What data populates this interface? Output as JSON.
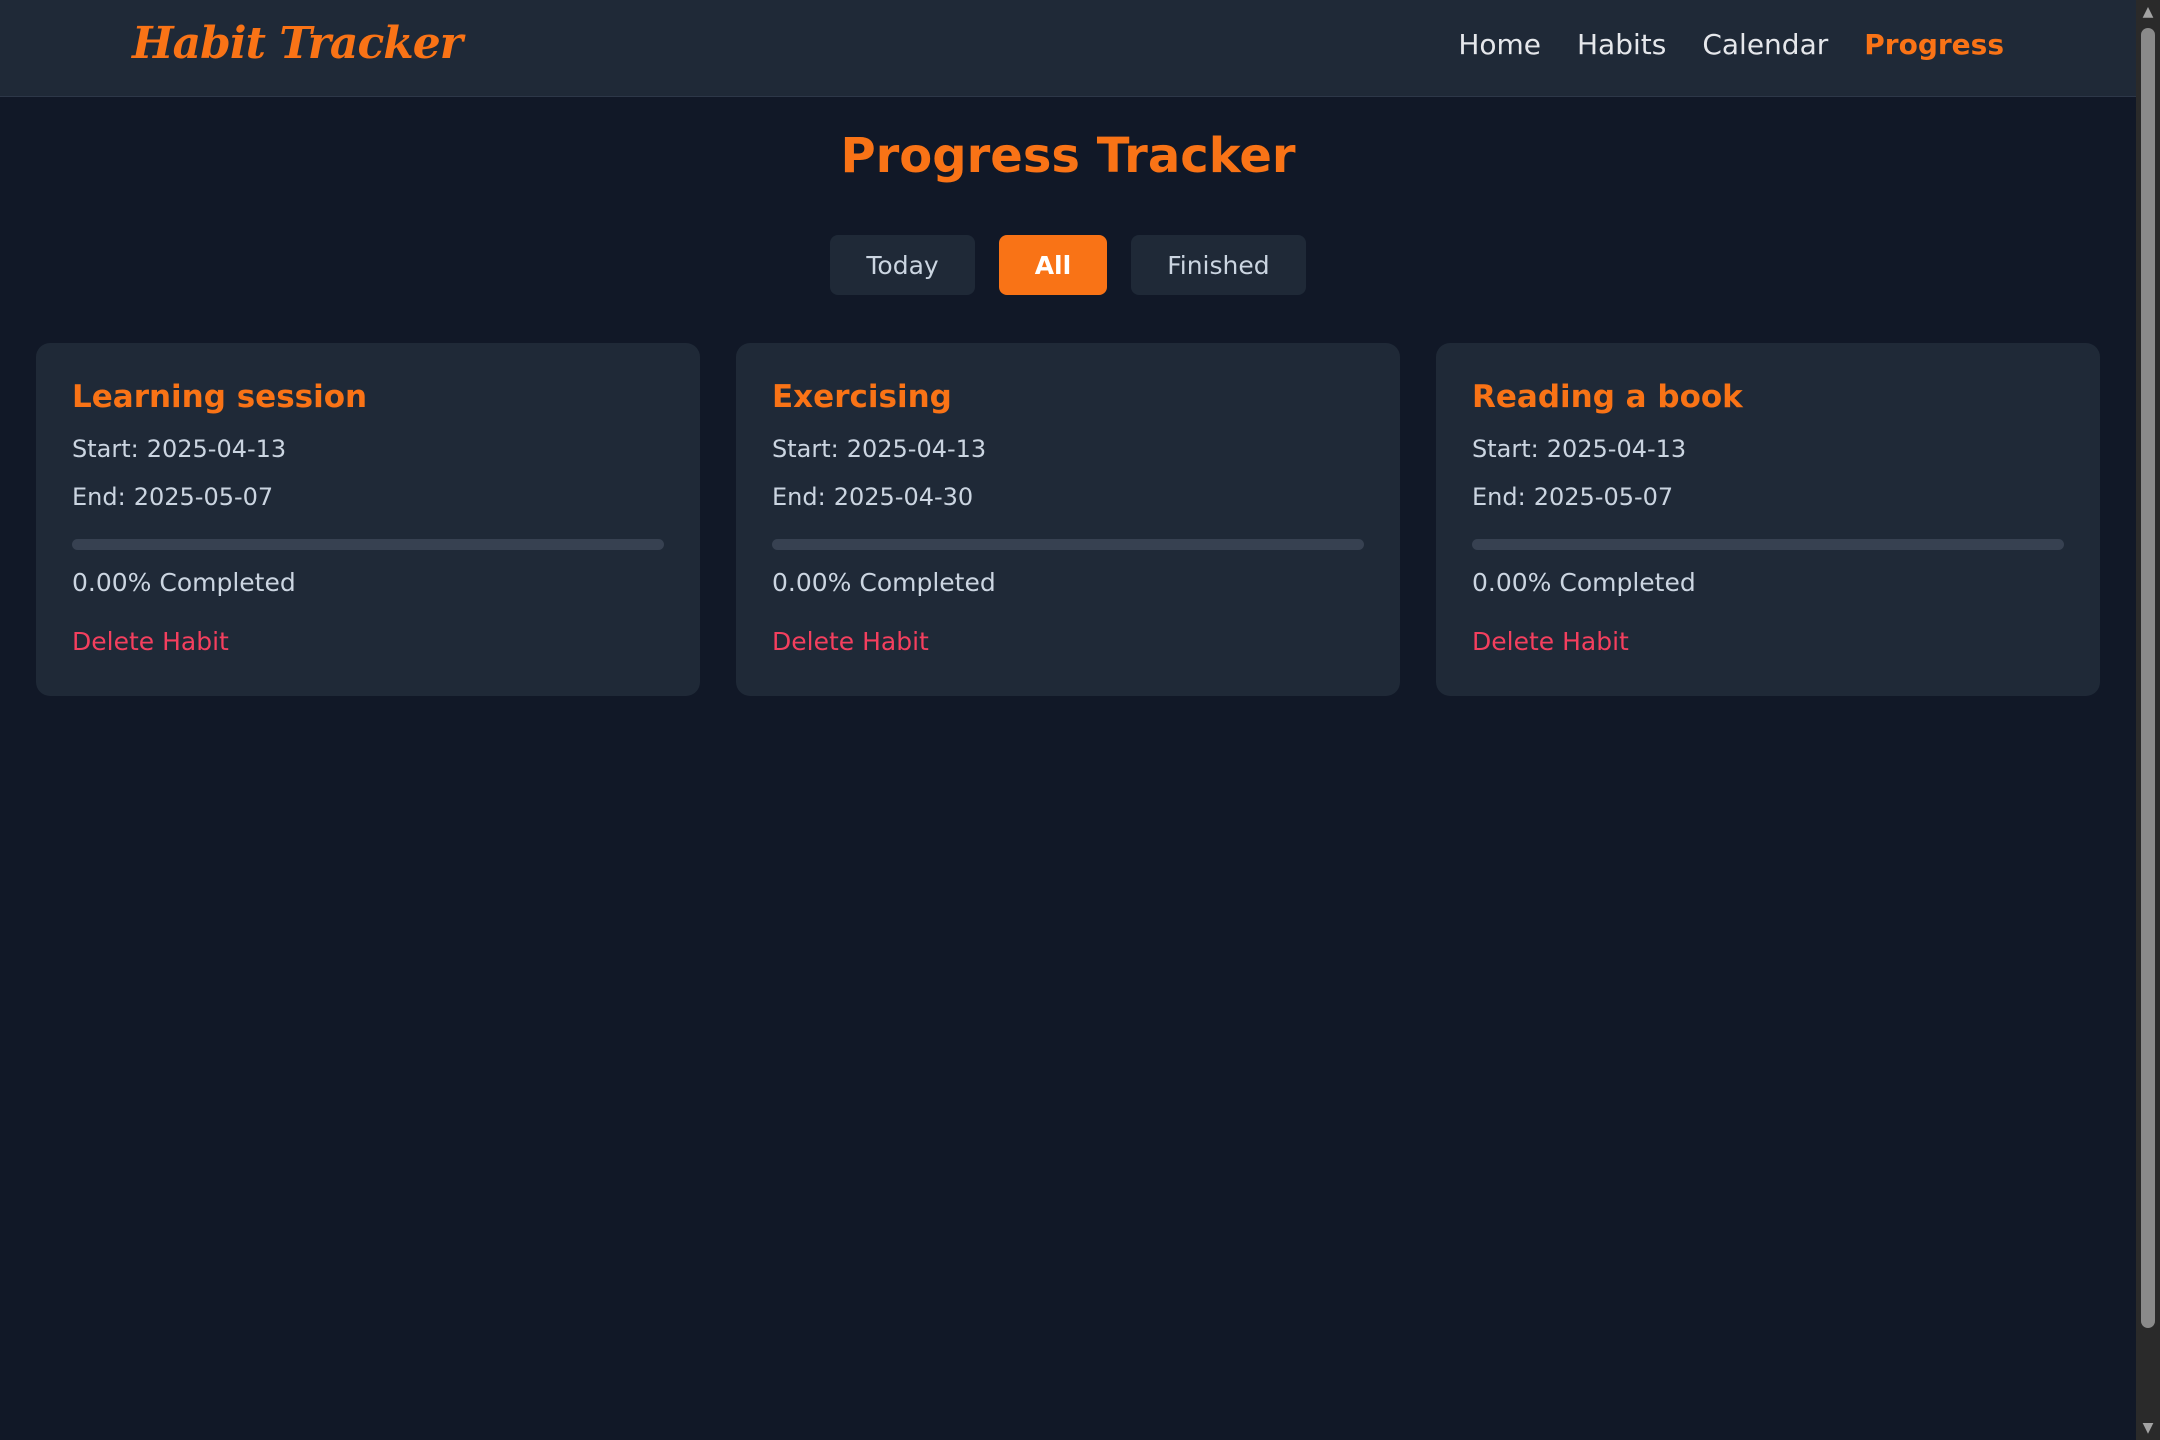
{
  "navbar": {
    "brand": "Habit Tracker",
    "links": [
      {
        "label": "Home",
        "active": false
      },
      {
        "label": "Habits",
        "active": false
      },
      {
        "label": "Calendar",
        "active": false
      },
      {
        "label": "Progress",
        "active": true
      }
    ]
  },
  "page": {
    "title": "Progress Tracker"
  },
  "filters": [
    {
      "label": "Today",
      "active": false
    },
    {
      "label": "All",
      "active": true
    },
    {
      "label": "Finished",
      "active": false
    }
  ],
  "habits": [
    {
      "name": "Learning session",
      "start_label": "Start:",
      "start": "2025-04-13",
      "end_label": "End:",
      "end": "2025-05-07",
      "progress": 0,
      "completed_text": "0.00% Completed",
      "delete_label": "Delete Habit"
    },
    {
      "name": "Exercising",
      "start_label": "Start:",
      "start": "2025-04-13",
      "end_label": "End:",
      "end": "2025-04-30",
      "progress": 0,
      "completed_text": "0.00% Completed",
      "delete_label": "Delete Habit"
    },
    {
      "name": "Reading a book",
      "start_label": "Start:",
      "start": "2025-04-13",
      "end_label": "End:",
      "end": "2025-05-07",
      "progress": 0,
      "completed_text": "0.00% Completed",
      "delete_label": "Delete Habit"
    }
  ],
  "colors": {
    "accent": "#f97316",
    "background": "#111827",
    "card": "#1f2937",
    "danger": "#f43f5e"
  },
  "icons": {
    "scroll_up": "scroll-up-arrow-icon",
    "scroll_down": "scroll-down-arrow-icon"
  }
}
